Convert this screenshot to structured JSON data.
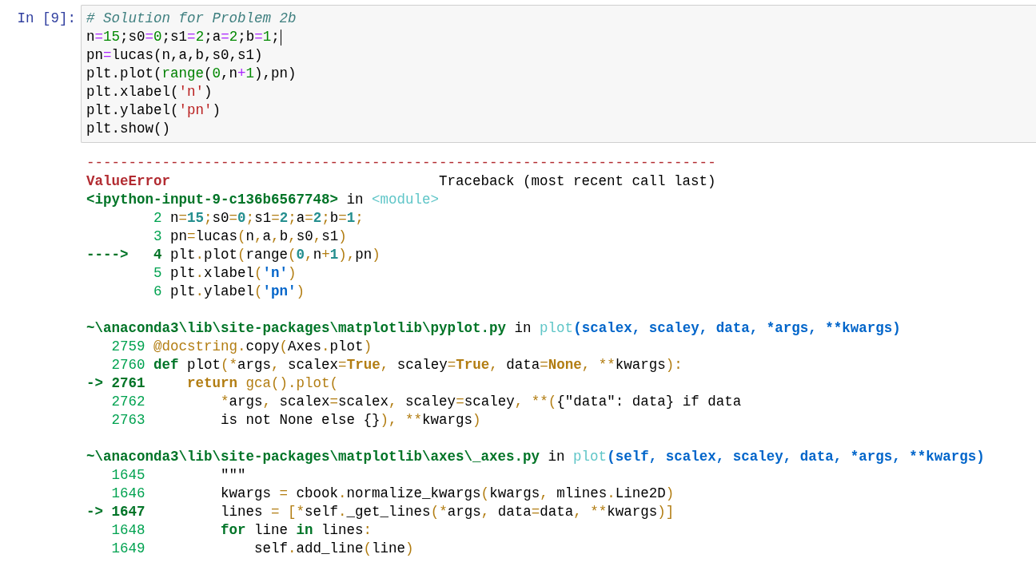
{
  "cell": {
    "prompt": "In [9]:",
    "code": [
      {
        "tokens": [
          {
            "text": "# Solution for Problem 2b",
            "kind": "comment"
          }
        ]
      },
      {
        "cursor": true,
        "tokens": [
          {
            "text": "n",
            "kind": "plain"
          },
          {
            "text": "=",
            "kind": "op"
          },
          {
            "text": "15",
            "kind": "num"
          },
          {
            "text": ";s0",
            "kind": "plain"
          },
          {
            "text": "=",
            "kind": "op"
          },
          {
            "text": "0",
            "kind": "num"
          },
          {
            "text": ";s1",
            "kind": "plain"
          },
          {
            "text": "=",
            "kind": "op"
          },
          {
            "text": "2",
            "kind": "num"
          },
          {
            "text": ";a",
            "kind": "plain"
          },
          {
            "text": "=",
            "kind": "op"
          },
          {
            "text": "2",
            "kind": "num"
          },
          {
            "text": ";b",
            "kind": "plain"
          },
          {
            "text": "=",
            "kind": "op"
          },
          {
            "text": "1",
            "kind": "num"
          },
          {
            "text": ";",
            "kind": "plain"
          }
        ]
      },
      {
        "tokens": [
          {
            "text": "pn",
            "kind": "plain"
          },
          {
            "text": "=",
            "kind": "op"
          },
          {
            "text": "lucas(n,a,b,s0,s1)",
            "kind": "plain"
          }
        ]
      },
      {
        "tokens": [
          {
            "text": "plt.plot(",
            "kind": "plain"
          },
          {
            "text": "range",
            "kind": "builtin"
          },
          {
            "text": "(",
            "kind": "plain"
          },
          {
            "text": "0",
            "kind": "num"
          },
          {
            "text": ",n",
            "kind": "plain"
          },
          {
            "text": "+",
            "kind": "op"
          },
          {
            "text": "1",
            "kind": "num"
          },
          {
            "text": "),pn)",
            "kind": "plain"
          }
        ]
      },
      {
        "tokens": [
          {
            "text": "plt.xlabel(",
            "kind": "plain"
          },
          {
            "text": "'n'",
            "kind": "string"
          },
          {
            "text": ")",
            "kind": "plain"
          }
        ]
      },
      {
        "tokens": [
          {
            "text": "plt.ylabel(",
            "kind": "plain"
          },
          {
            "text": "'pn'",
            "kind": "string"
          },
          {
            "text": ")",
            "kind": "plain"
          }
        ]
      },
      {
        "tokens": [
          {
            "text": "plt.show()",
            "kind": "plain"
          }
        ]
      }
    ]
  },
  "output": {
    "separator": "---------------------------------------------------------------------------",
    "error_name": "ValueError",
    "traceback_note": "Traceback (most recent call last)",
    "frames": [
      {
        "header": [
          {
            "text": "<ipython-input-9-c136b6567748>",
            "kind": "path"
          },
          {
            "text": " in ",
            "kind": "plain"
          },
          {
            "text": "<module>",
            "kind": "func"
          }
        ],
        "lines": [
          {
            "number": "2",
            "current": false,
            "tokens": [
              {
                "text": "n",
                "kind": "plain"
              },
              {
                "text": "=",
                "kind": "op"
              },
              {
                "text": "15",
                "kind": "num"
              },
              {
                "text": ";",
                "kind": "op"
              },
              {
                "text": "s0",
                "kind": "plain"
              },
              {
                "text": "=",
                "kind": "op"
              },
              {
                "text": "0",
                "kind": "num"
              },
              {
                "text": ";",
                "kind": "op"
              },
              {
                "text": "s1",
                "kind": "plain"
              },
              {
                "text": "=",
                "kind": "op"
              },
              {
                "text": "2",
                "kind": "num"
              },
              {
                "text": ";",
                "kind": "op"
              },
              {
                "text": "a",
                "kind": "plain"
              },
              {
                "text": "=",
                "kind": "op"
              },
              {
                "text": "2",
                "kind": "num"
              },
              {
                "text": ";",
                "kind": "op"
              },
              {
                "text": "b",
                "kind": "plain"
              },
              {
                "text": "=",
                "kind": "op"
              },
              {
                "text": "1",
                "kind": "num"
              },
              {
                "text": ";",
                "kind": "op"
              }
            ]
          },
          {
            "number": "3",
            "current": false,
            "tokens": [
              {
                "text": "pn",
                "kind": "plain"
              },
              {
                "text": "=",
                "kind": "op"
              },
              {
                "text": "lucas",
                "kind": "plain"
              },
              {
                "text": "(",
                "kind": "op"
              },
              {
                "text": "n",
                "kind": "plain"
              },
              {
                "text": ",",
                "kind": "op"
              },
              {
                "text": "a",
                "kind": "plain"
              },
              {
                "text": ",",
                "kind": "op"
              },
              {
                "text": "b",
                "kind": "plain"
              },
              {
                "text": ",",
                "kind": "op"
              },
              {
                "text": "s0",
                "kind": "plain"
              },
              {
                "text": ",",
                "kind": "op"
              },
              {
                "text": "s1",
                "kind": "plain"
              },
              {
                "text": ")",
                "kind": "op"
              }
            ]
          },
          {
            "number": "4",
            "current": true,
            "arrow": "---->",
            "tokens": [
              {
                "text": "plt",
                "kind": "plain"
              },
              {
                "text": ".",
                "kind": "op"
              },
              {
                "text": "plot",
                "kind": "plain"
              },
              {
                "text": "(",
                "kind": "op"
              },
              {
                "text": "range",
                "kind": "plain"
              },
              {
                "text": "(",
                "kind": "op"
              },
              {
                "text": "0",
                "kind": "num"
              },
              {
                "text": ",",
                "kind": "op"
              },
              {
                "text": "n",
                "kind": "plain"
              },
              {
                "text": "+",
                "kind": "op"
              },
              {
                "text": "1",
                "kind": "num"
              },
              {
                "text": ")",
                "kind": "op"
              },
              {
                "text": ",",
                "kind": "op"
              },
              {
                "text": "pn",
                "kind": "plain"
              },
              {
                "text": ")",
                "kind": "op"
              }
            ]
          },
          {
            "number": "5",
            "current": false,
            "tokens": [
              {
                "text": "plt",
                "kind": "plain"
              },
              {
                "text": ".",
                "kind": "op"
              },
              {
                "text": "xlabel",
                "kind": "plain"
              },
              {
                "text": "(",
                "kind": "op"
              },
              {
                "text": "'n'",
                "kind": "string"
              },
              {
                "text": ")",
                "kind": "op"
              }
            ]
          },
          {
            "number": "6",
            "current": false,
            "tokens": [
              {
                "text": "plt",
                "kind": "plain"
              },
              {
                "text": ".",
                "kind": "op"
              },
              {
                "text": "ylabel",
                "kind": "plain"
              },
              {
                "text": "(",
                "kind": "op"
              },
              {
                "text": "'pn'",
                "kind": "string"
              },
              {
                "text": ")",
                "kind": "op"
              }
            ]
          }
        ]
      },
      {
        "header": [
          {
            "text": "~\\anaconda3\\lib\\site-packages\\matplotlib\\pyplot.py",
            "kind": "path"
          },
          {
            "text": " in ",
            "kind": "plain"
          },
          {
            "text": "plot",
            "kind": "func"
          },
          {
            "text": "(scalex, scaley, data, *args, **kwargs)",
            "kind": "args"
          }
        ],
        "lines": [
          {
            "number": "2759",
            "current": false,
            "tokens": [
              {
                "text": "@docstring",
                "kind": "deco"
              },
              {
                "text": ".",
                "kind": "op"
              },
              {
                "text": "copy",
                "kind": "plain"
              },
              {
                "text": "(",
                "kind": "op"
              },
              {
                "text": "Axes",
                "kind": "plain"
              },
              {
                "text": ".",
                "kind": "op"
              },
              {
                "text": "plot",
                "kind": "plain"
              },
              {
                "text": ")",
                "kind": "op"
              }
            ]
          },
          {
            "number": "2760",
            "current": false,
            "tokens": [
              {
                "text": "def",
                "kind": "keyword"
              },
              {
                "text": " plot",
                "kind": "plain"
              },
              {
                "text": "(",
                "kind": "op"
              },
              {
                "text": "*",
                "kind": "op"
              },
              {
                "text": "args",
                "kind": "plain"
              },
              {
                "text": ",",
                "kind": "op"
              },
              {
                "text": " scalex",
                "kind": "plain"
              },
              {
                "text": "=",
                "kind": "op"
              },
              {
                "text": "True",
                "kind": "const"
              },
              {
                "text": ",",
                "kind": "op"
              },
              {
                "text": " scaley",
                "kind": "plain"
              },
              {
                "text": "=",
                "kind": "op"
              },
              {
                "text": "True",
                "kind": "const"
              },
              {
                "text": ",",
                "kind": "op"
              },
              {
                "text": " data",
                "kind": "plain"
              },
              {
                "text": "=",
                "kind": "op"
              },
              {
                "text": "None",
                "kind": "const"
              },
              {
                "text": ", ",
                "kind": "op"
              },
              {
                "text": "**",
                "kind": "op"
              },
              {
                "text": "kwargs",
                "kind": "plain"
              },
              {
                "text": ")",
                "kind": "op"
              },
              {
                "text": ":",
                "kind": "op"
              }
            ]
          },
          {
            "number": "2761",
            "current": true,
            "arrow": "->",
            "tokens": [
              {
                "text": "    return",
                "kind": "const"
              },
              {
                "text": " gca",
                "kind": "deco"
              },
              {
                "text": "(",
                "kind": "op"
              },
              {
                "text": ")",
                "kind": "op"
              },
              {
                "text": ".",
                "kind": "op"
              },
              {
                "text": "plot",
                "kind": "deco"
              },
              {
                "text": "(",
                "kind": "op"
              }
            ]
          },
          {
            "number": "2762",
            "current": false,
            "tokens": [
              {
                "text": "        *",
                "kind": "op"
              },
              {
                "text": "args",
                "kind": "plain"
              },
              {
                "text": ",",
                "kind": "op"
              },
              {
                "text": " scalex",
                "kind": "plain"
              },
              {
                "text": "=",
                "kind": "op"
              },
              {
                "text": "scalex",
                "kind": "plain"
              },
              {
                "text": ",",
                "kind": "op"
              },
              {
                "text": " scaley",
                "kind": "plain"
              },
              {
                "text": "=",
                "kind": "op"
              },
              {
                "text": "scaley",
                "kind": "plain"
              },
              {
                "text": ", ",
                "kind": "op"
              },
              {
                "text": "**",
                "kind": "op"
              },
              {
                "text": "(",
                "kind": "op"
              },
              {
                "text": "{\"data\": data} if data",
                "kind": "plain"
              }
            ]
          },
          {
            "number": "2763",
            "current": false,
            "tokens": [
              {
                "text": "        is not None else {}",
                "kind": "plain"
              },
              {
                "text": ")",
                "kind": "op"
              },
              {
                "text": ", ",
                "kind": "op"
              },
              {
                "text": "**",
                "kind": "op"
              },
              {
                "text": "kwargs",
                "kind": "plain"
              },
              {
                "text": ")",
                "kind": "op"
              }
            ]
          }
        ]
      },
      {
        "header": [
          {
            "text": "~\\anaconda3\\lib\\site-packages\\matplotlib\\axes\\_axes.py",
            "kind": "path"
          },
          {
            "text": " in ",
            "kind": "plain"
          },
          {
            "text": "plot",
            "kind": "func"
          },
          {
            "text": "(self, scalex, scaley, data, *args, **kwargs)",
            "kind": "args"
          }
        ],
        "lines": [
          {
            "number": "1645",
            "current": false,
            "tokens": [
              {
                "text": "        \"\"\"",
                "kind": "plain"
              }
            ]
          },
          {
            "number": "1646",
            "current": false,
            "tokens": [
              {
                "text": "        kwargs ",
                "kind": "plain"
              },
              {
                "text": "=",
                "kind": "op"
              },
              {
                "text": " cbook",
                "kind": "plain"
              },
              {
                "text": ".",
                "kind": "op"
              },
              {
                "text": "normalize_kwargs",
                "kind": "plain"
              },
              {
                "text": "(",
                "kind": "op"
              },
              {
                "text": "kwargs",
                "kind": "plain"
              },
              {
                "text": ",",
                "kind": "op"
              },
              {
                "text": " mlines",
                "kind": "plain"
              },
              {
                "text": ".",
                "kind": "op"
              },
              {
                "text": "Line2D",
                "kind": "plain"
              },
              {
                "text": ")",
                "kind": "op"
              }
            ]
          },
          {
            "number": "1647",
            "current": true,
            "arrow": "->",
            "tokens": [
              {
                "text": "        lines ",
                "kind": "plain"
              },
              {
                "text": "= ",
                "kind": "op"
              },
              {
                "text": "[",
                "kind": "op"
              },
              {
                "text": "*",
                "kind": "op"
              },
              {
                "text": "self",
                "kind": "plain"
              },
              {
                "text": ".",
                "kind": "op"
              },
              {
                "text": "_get_lines",
                "kind": "plain"
              },
              {
                "text": "(",
                "kind": "op"
              },
              {
                "text": "*",
                "kind": "op"
              },
              {
                "text": "args",
                "kind": "plain"
              },
              {
                "text": ",",
                "kind": "op"
              },
              {
                "text": " data",
                "kind": "plain"
              },
              {
                "text": "=",
                "kind": "op"
              },
              {
                "text": "data",
                "kind": "plain"
              },
              {
                "text": ", ",
                "kind": "op"
              },
              {
                "text": "**",
                "kind": "op"
              },
              {
                "text": "kwargs",
                "kind": "plain"
              },
              {
                "text": ")",
                "kind": "op"
              },
              {
                "text": "]",
                "kind": "op"
              }
            ]
          },
          {
            "number": "1648",
            "current": false,
            "tokens": [
              {
                "text": "        for",
                "kind": "keyword"
              },
              {
                "text": " line ",
                "kind": "plain"
              },
              {
                "text": "in",
                "kind": "keyword"
              },
              {
                "text": " lines",
                "kind": "plain"
              },
              {
                "text": ":",
                "kind": "op"
              }
            ]
          },
          {
            "number": "1649",
            "current": false,
            "tokens": [
              {
                "text": "            self",
                "kind": "plain"
              },
              {
                "text": ".",
                "kind": "op"
              },
              {
                "text": "add_line",
                "kind": "plain"
              },
              {
                "text": "(",
                "kind": "op"
              },
              {
                "text": "line",
                "kind": "plain"
              },
              {
                "text": ")",
                "kind": "op"
              }
            ]
          }
        ]
      }
    ]
  }
}
